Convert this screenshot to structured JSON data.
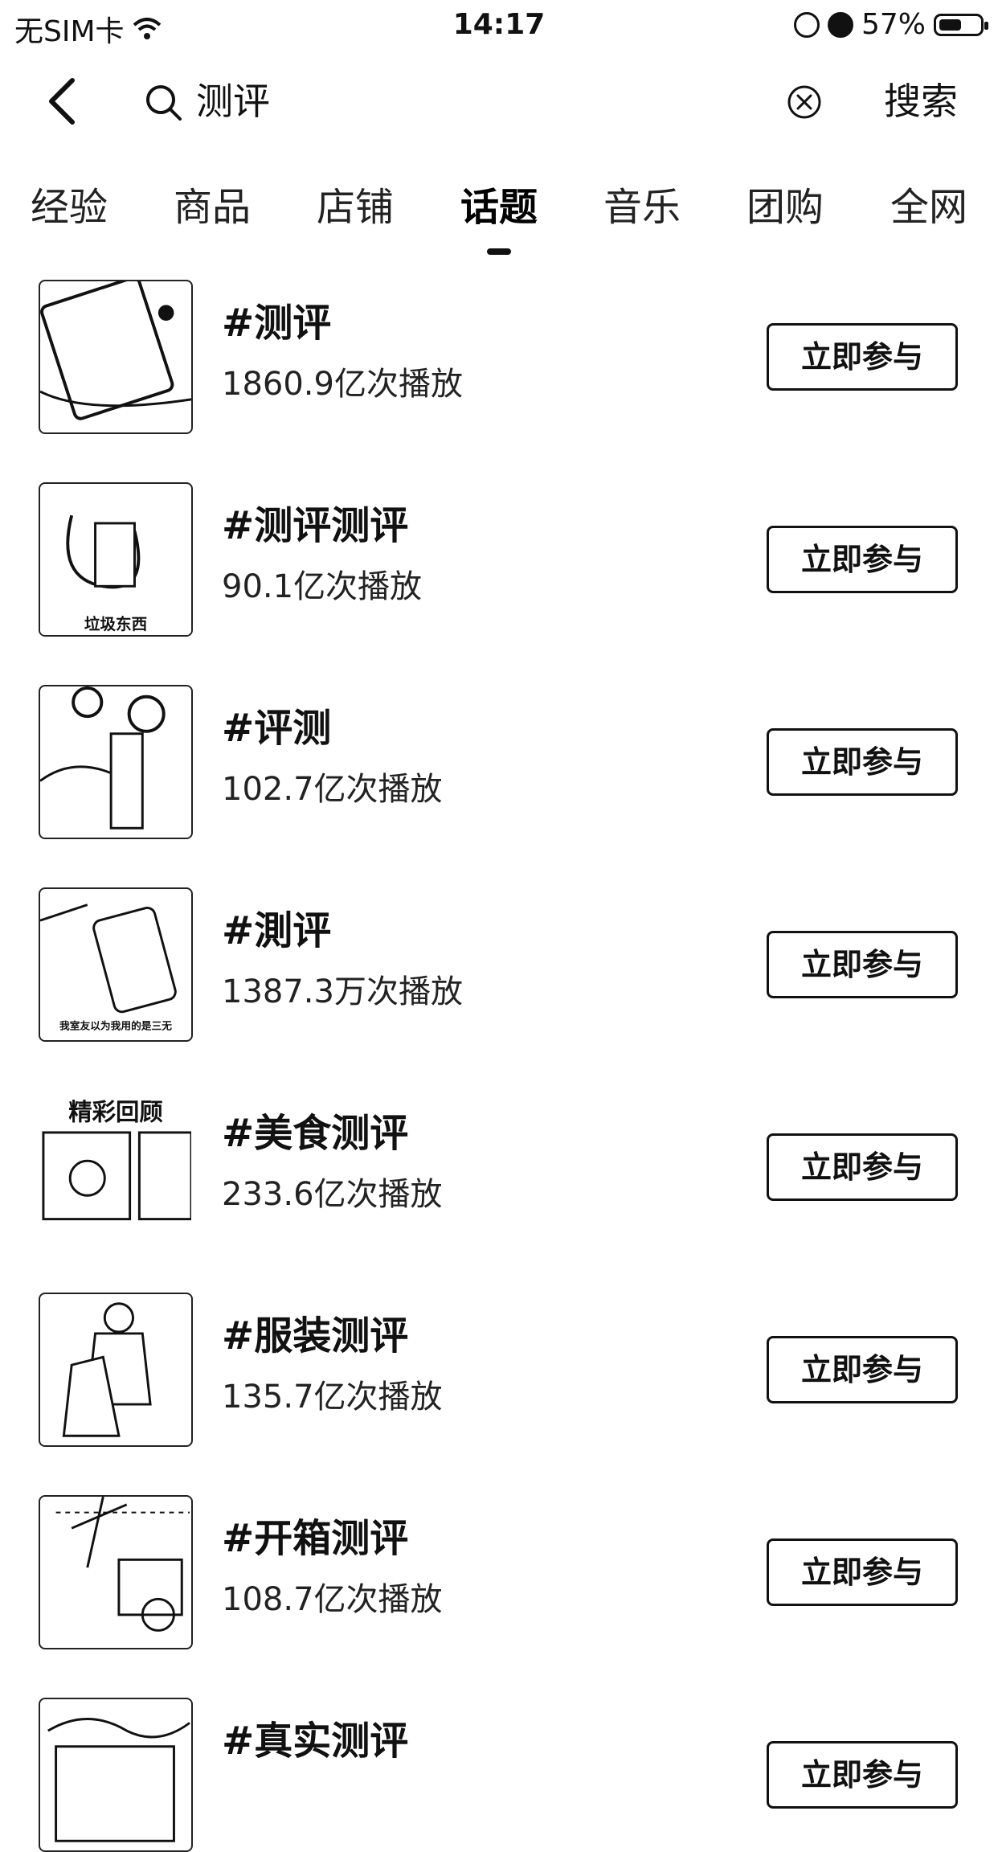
{
  "status_bar": {
    "carrier": "无SIM卡",
    "time": "14:17",
    "battery_text": "57%",
    "battery_level": 0.57
  },
  "search": {
    "query": "测评",
    "button_label": "搜索"
  },
  "tabs": [
    {
      "label": "经验"
    },
    {
      "label": "商品"
    },
    {
      "label": "店铺"
    },
    {
      "label": "话题",
      "active": true
    },
    {
      "label": "音乐"
    },
    {
      "label": "团购"
    },
    {
      "label": "全网"
    }
  ],
  "topics": [
    {
      "title": "#测评",
      "plays": "1860.9亿次播放",
      "join_label": "立即参与",
      "thumb_caption": ""
    },
    {
      "title": "#测评测评",
      "plays": "90.1亿次播放",
      "join_label": "立即参与",
      "thumb_caption": "垃圾东西"
    },
    {
      "title": "#评测",
      "plays": "102.7亿次播放",
      "join_label": "立即参与",
      "thumb_caption": ""
    },
    {
      "title": "#測评",
      "plays": "1387.3万次播放",
      "join_label": "立即参与",
      "thumb_caption": "我室友以为我用的是三无"
    },
    {
      "title": "#美食测评",
      "plays": "233.6亿次播放",
      "join_label": "立即参与",
      "thumb_caption": "精彩回顾"
    },
    {
      "title": "#服装测评",
      "plays": "135.7亿次播放",
      "join_label": "立即参与",
      "thumb_caption": ""
    },
    {
      "title": "#开箱测评",
      "plays": "108.7亿次播放",
      "join_label": "立即参与",
      "thumb_caption": ""
    },
    {
      "title": "#真实测评",
      "plays": "",
      "join_label": "立即参与",
      "thumb_caption": ""
    }
  ]
}
